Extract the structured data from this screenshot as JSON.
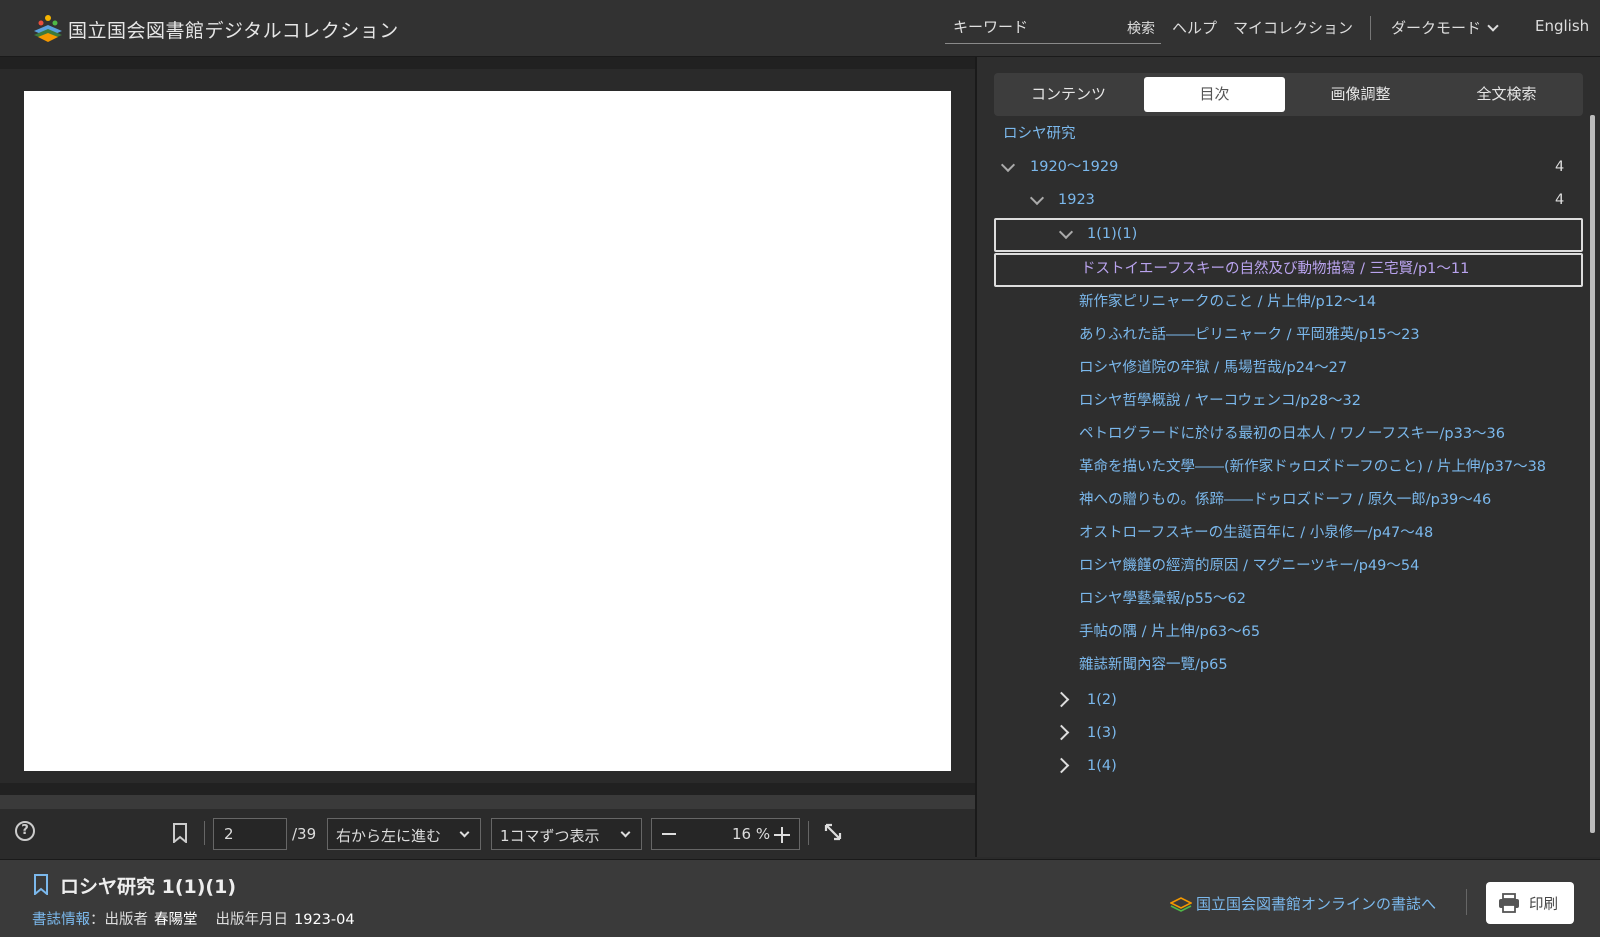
{
  "header": {
    "app_title": "国立国会図書館デジタルコレクション",
    "search_placeholder": "キーワード",
    "search_label": "検索",
    "help_label": "ヘルプ",
    "my_collection_label": "マイコレクション",
    "dark_mode_label": "ダークモード",
    "language_label": "English"
  },
  "toolbar": {
    "help_symbol": "?",
    "page_value": "2",
    "page_total": "/39",
    "direction_select": "右から左に進む",
    "display_select": "1コマずつ表示",
    "zoom_value": "16 %"
  },
  "panel": {
    "tabs": [
      {
        "label": "コンテンツ",
        "active": false
      },
      {
        "label": "目次",
        "active": true
      },
      {
        "label": "画像調整",
        "active": false
      },
      {
        "label": "全文検索",
        "active": false
      }
    ],
    "toc": {
      "root": "ロシヤ研究",
      "decade": {
        "label": "1920～1929",
        "count": "4"
      },
      "year": {
        "label": "1923",
        "count": "4"
      },
      "issue": "1(1)(1)",
      "articles": [
        "ドストイエーフスキーの自然及び動物描寫 / 三宅賢/p1～11",
        "新作家ピリニャークのこと / 片上伸/p12～14",
        "ありふれた話――ピリニャーク / 平岡雅英/p15～23",
        "ロシヤ修道院の牢獄 / 馬場哲哉/p24～27",
        "ロシヤ哲學概說 / ヤーコウェンコ/p28～32",
        "ペトログラードに於ける最初の日本人 / ワノーフスキー/p33～36",
        "革命を描いた文學――(新作家ドゥロズドーフのこと) / 片上伸/p37～38",
        "神への贈りもの。係蹄――ドゥロズドーフ / 原久一郎/p39～46",
        "オストローフスキーの生誕百年に / 小泉修一/p47～48",
        "ロシヤ饑饉の經濟的原因 / マグニーツキー/p49～54",
        "ロシヤ學藝彙報/p55～62",
        "手帖の隅 / 片上伸/p63～65",
        "雜誌新聞內容一覽/p65"
      ],
      "other_issues": [
        "1(2)",
        "1(3)",
        "1(4)"
      ]
    }
  },
  "footer": {
    "title": "ロシヤ研究 1(1)(1)",
    "bib_label": "書誌情報",
    "publisher_label": "：出版者",
    "publisher_value": "春陽堂",
    "date_label": "出版年月日",
    "date_value": "1923-04",
    "ndl_link": "国立国会図書館オンラインの書誌へ",
    "print_label": "印刷"
  },
  "colors": {
    "link": "#7bb8ec",
    "visited_link": "#b9a3ee",
    "background": "#2b2b2b",
    "panel": "#2e2e2e"
  },
  "icons": [
    "logo-icon",
    "chevron-down-icon",
    "help-icon",
    "bookmark-icon",
    "fullscreen-icon",
    "chevron-right-icon",
    "library-icon",
    "printer-icon",
    "drag-handle-icon"
  ]
}
